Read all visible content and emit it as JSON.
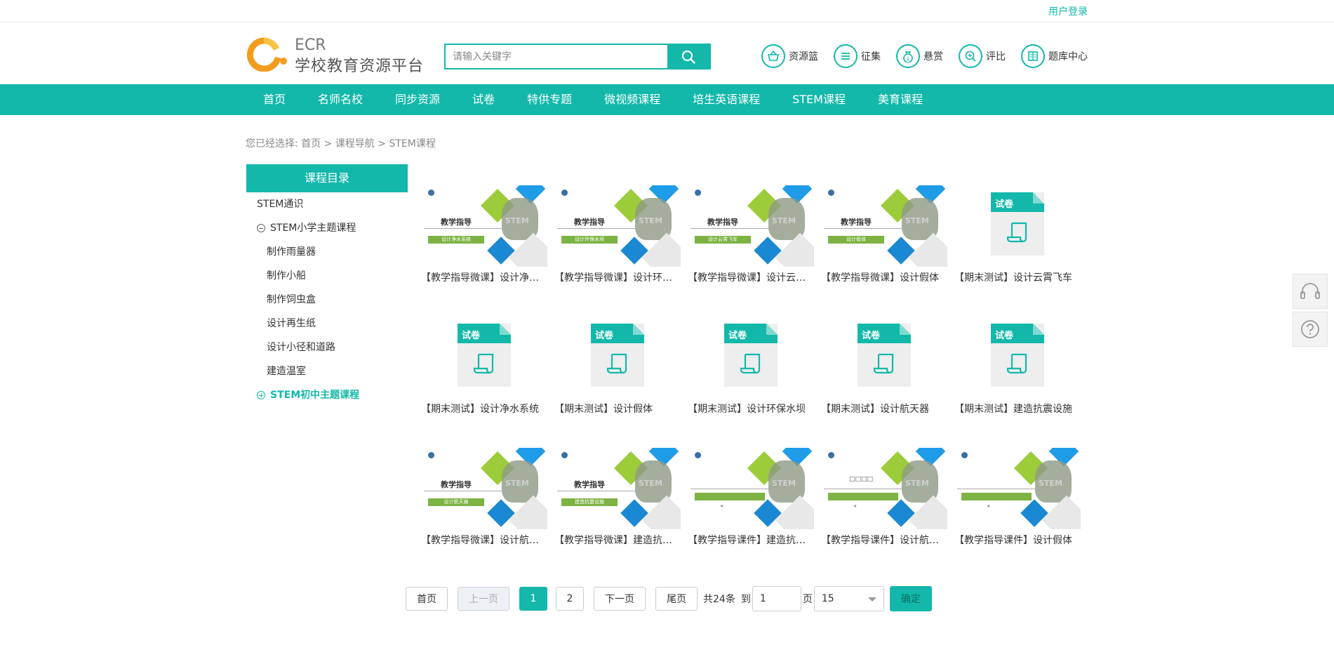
{
  "top": {
    "login": "用户登录"
  },
  "logo": {
    "ecr": "ECR",
    "name": "学校教育资源平台"
  },
  "search": {
    "placeholder": "请输入关键字"
  },
  "tools": [
    {
      "label": "资源篮",
      "icon": "basket-icon"
    },
    {
      "label": "征集",
      "icon": "list-icon"
    },
    {
      "label": "悬赏",
      "icon": "money-bag-icon"
    },
    {
      "label": "评比",
      "icon": "zoom-icon"
    },
    {
      "label": "题库中心",
      "icon": "book-icon"
    }
  ],
  "nav": [
    "首页",
    "名师名校",
    "同步资源",
    "试卷",
    "特供专题",
    "微视频课程",
    "培生英语课程",
    "STEM课程",
    "美育课程"
  ],
  "breadcrumb": {
    "prefix": "您已经选择:",
    "home": "首页",
    "sep1": ">",
    "level1": "课程导航",
    "sep2": ">",
    "level2": "STEM课程"
  },
  "sidebar": {
    "title": "课程目录",
    "general": "STEM通识",
    "primary": "STEM小学主题课程",
    "primary_items": [
      "制作雨量器",
      "制作小船",
      "制作饲虫盒",
      "设计再生纸",
      "设计小径和道路",
      "建造温室"
    ],
    "junior": "STEM初中主题课程"
  },
  "cards": [
    {
      "title": "【教学指导微课】设计净水系统",
      "type": "slide",
      "bar": "设计净水系统"
    },
    {
      "title": "【教学指导微课】设计环保水坝",
      "type": "slide",
      "bar": "设计环保水坝"
    },
    {
      "title": "【教学指导微课】设计云霄飞车",
      "type": "slide",
      "bar": "设计云霄飞车"
    },
    {
      "title": "【教学指导微课】设计假体",
      "type": "slide",
      "bar": "设计假体"
    },
    {
      "title": "【期末测试】设计云霄飞车",
      "type": "exam"
    },
    {
      "title": "【期末测试】设计净水系统",
      "type": "exam"
    },
    {
      "title": "【期末测试】设计假体",
      "type": "exam"
    },
    {
      "title": "【期末测试】设计环保水坝",
      "type": "exam"
    },
    {
      "title": "【期末测试】设计航天器",
      "type": "exam"
    },
    {
      "title": "【期末测试】建造抗震设施",
      "type": "exam"
    },
    {
      "title": "【教学指导微课】设计航天器",
      "type": "slide",
      "bar": "设计航天器"
    },
    {
      "title": "【教学指导微课】建造抗震设施",
      "type": "slide",
      "bar": "建造抗震设施"
    },
    {
      "title": "【教学指导课件】建造抗震设施",
      "type": "courseware"
    },
    {
      "title": "【教学指导课件】设计航天器",
      "type": "courseware"
    },
    {
      "title": "【教学指导课件】设计假体",
      "type": "courseware"
    }
  ],
  "slide_text": {
    "heading": "教学指导",
    "stem": "STEM",
    "exam_label": "试卷",
    "placeholder_box": "□□□□"
  },
  "pager": {
    "first": "首页",
    "prev": "上一页",
    "page1": "1",
    "page2": "2",
    "next": "下一页",
    "last": "尾页",
    "total": "共24条",
    "goto": "到",
    "page_value": "1",
    "page_unit": "页",
    "page_size": "15",
    "confirm": "确定"
  },
  "colors": {
    "accent": "#13b8aa",
    "green": "#7cb342",
    "blue": "#1e9ce8"
  }
}
